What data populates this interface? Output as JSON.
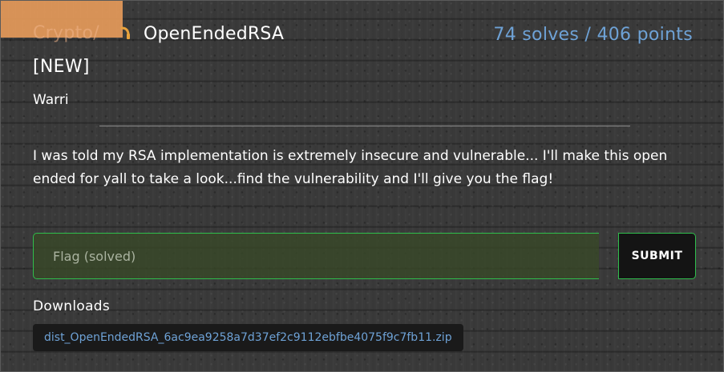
{
  "challenge": {
    "category": "Crypto/",
    "category_icon": "lamp-icon",
    "title": "OpenEndedRSA",
    "score_text": "74 solves / 406 points",
    "tag": "[NEW]",
    "author": "Warri",
    "description": "I was told my RSA implementation is extremely insecure and vulnerable... I'll make this open ended for yall to take a look...find the vulnerability and I'll give you the flag!"
  },
  "flag_form": {
    "placeholder": "Flag (solved)",
    "value": "",
    "submit_label": "SUBMIT"
  },
  "downloads": {
    "heading": "Downloads",
    "files": [
      {
        "name": "dist_OpenEndedRSA_6ac9ea9258a7d37ef2c9112ebfbe4075f9c7fb11.zip"
      }
    ]
  },
  "colors": {
    "ribbon": "#e59a5a",
    "score": "#6ea2d6",
    "link": "#6ea2d6",
    "input_border": "#2fbf4c"
  }
}
